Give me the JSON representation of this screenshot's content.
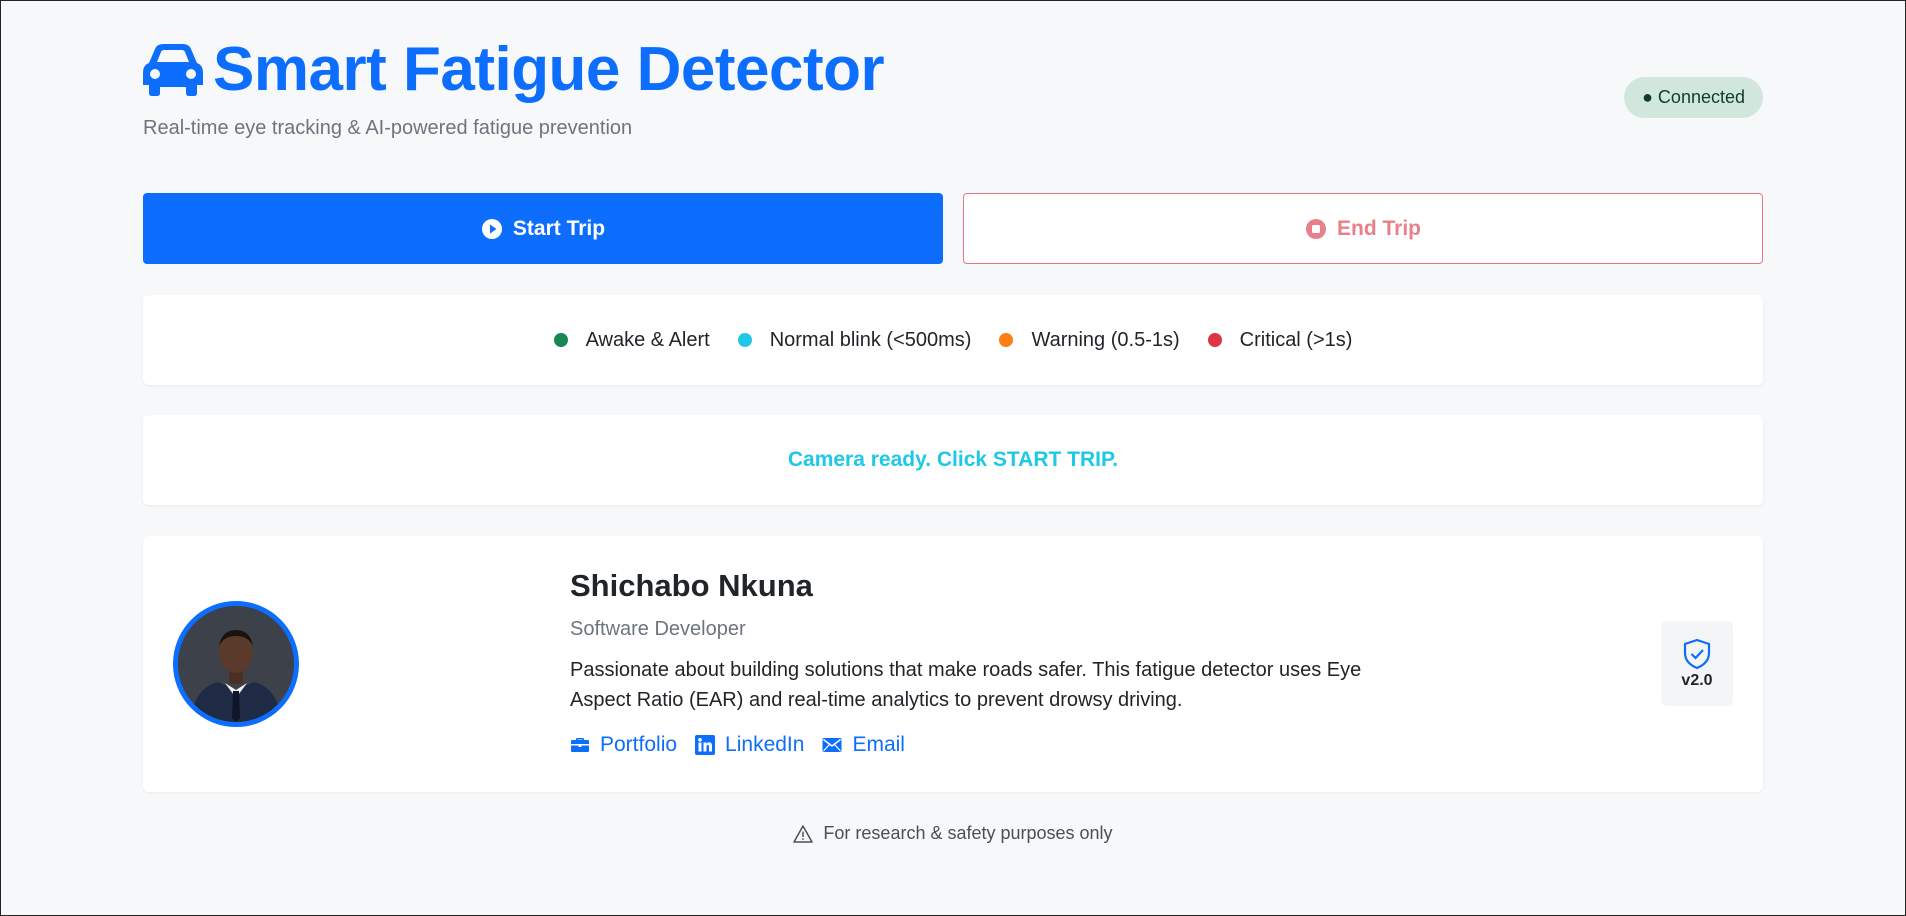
{
  "header": {
    "title": "Smart Fatigue Detector",
    "subtitle": "Real-time eye tracking & AI-powered fatigue prevention",
    "icon": "car-icon",
    "connection_status": "● Connected"
  },
  "controls": {
    "start_label": "Start Trip",
    "end_label": "End Trip"
  },
  "legend": {
    "items": [
      {
        "label": "Awake & Alert",
        "color": "#198754"
      },
      {
        "label": "Normal blink (<500ms)",
        "color": "#1ec8e6"
      },
      {
        "label": "Warning (0.5-1s)",
        "color": "#fd7e14"
      },
      {
        "label": "Critical (>1s)",
        "color": "#dc3545"
      }
    ]
  },
  "status": {
    "message": "Camera ready. Click START TRIP."
  },
  "profile": {
    "name": "Shichabo Nkuna",
    "role": "Software Developer",
    "bio": "Passionate about building solutions that make roads safer. This fatigue detector uses Eye Aspect Ratio (EAR) and real-time analytics to prevent drowsy driving.",
    "links": [
      {
        "label": "Portfolio",
        "icon": "briefcase-icon"
      },
      {
        "label": "LinkedIn",
        "icon": "linkedin-icon"
      },
      {
        "label": "Email",
        "icon": "envelope-icon"
      }
    ],
    "version": "v2.0"
  },
  "footer": {
    "note": "For research & safety purposes only"
  },
  "colors": {
    "primary": "#0d6efd",
    "danger_outline": "#e57883",
    "success_bg": "#d1e7dd",
    "info": "#1ec8e6"
  }
}
